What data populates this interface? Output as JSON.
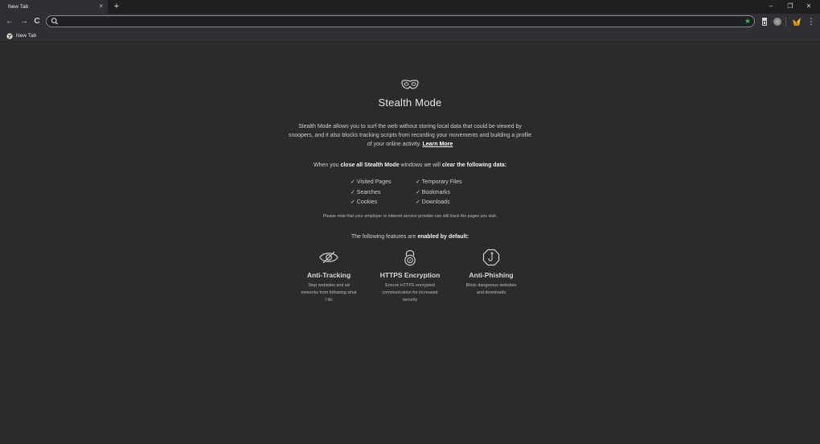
{
  "tab": {
    "title": "New Tab",
    "close": "×"
  },
  "new_tab_button": "+",
  "window_controls": {
    "minimize": "–",
    "restore": "❐",
    "close": "✕"
  },
  "nav": {
    "back": "←",
    "forward": "→",
    "reload": "C"
  },
  "omnibox": {
    "value": "",
    "placeholder": ""
  },
  "bookmarks": [
    {
      "label": "New Tab"
    }
  ],
  "page": {
    "title": "Stealth Mode",
    "description": "Stealth Mode allows you to surf the web without storing local data that could be viewed by snoopers, and it also blocks tracking scripts from recording your movements and building a profile of your online activity.",
    "learn_more": "Learn More",
    "clear_prefix": "When you",
    "clear_bold1": "close all Stealth Mode",
    "clear_mid": "windows we will",
    "clear_bold2": "clear the following data:",
    "cleared_left": [
      "✓ Visited Pages",
      "✓ Searches",
      "✓ Cookies"
    ],
    "cleared_right": [
      "✓ Temporary Files",
      "✓ Bookmarks",
      "✓ Downloads"
    ],
    "note": "Please note that your employer or internet service provider can still track the pages you visit.",
    "features_prefix": "The following features are",
    "features_bold": "enabled by default:",
    "features": [
      {
        "title": "Anti-Tracking",
        "desc": "Stop websites and ad networks from following what I do",
        "icon": "eye-slash-icon"
      },
      {
        "title": "HTTPS Encryption",
        "desc": "Ensure HTTPS encrypted communication for increased security",
        "icon": "lock-icon"
      },
      {
        "title": "Anti-Phishing",
        "desc": "Block dangerous websites and downloads",
        "icon": "hook-octagon-icon"
      }
    ]
  },
  "colors": {
    "background": "#2b2b2b",
    "accent_star": "#2ebd59",
    "toolbar": "#2f3033"
  }
}
